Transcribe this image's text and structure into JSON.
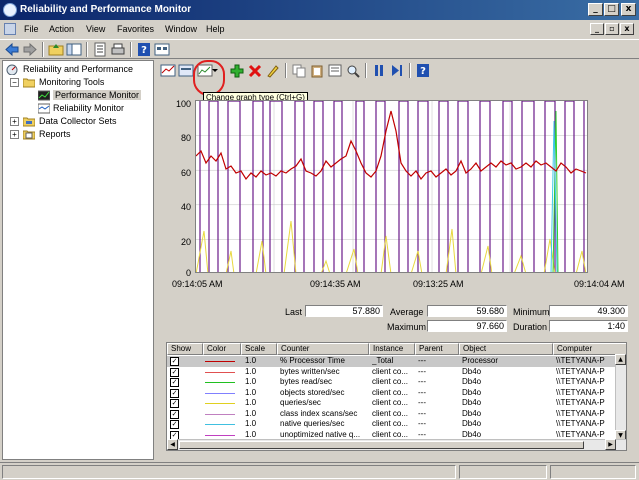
{
  "window": {
    "title": "Reliability and Performance Monitor"
  },
  "menu": [
    "File",
    "Action",
    "View",
    "Favorites",
    "Window",
    "Help"
  ],
  "window_buttons": {
    "minimize": "_",
    "maximize": "□",
    "close": "x"
  },
  "mdi_buttons": {
    "minimize": "_",
    "restore": "▫",
    "close": "x"
  },
  "tree": {
    "root": "Reliability and Performance",
    "monitoring_tools": "Monitoring Tools",
    "performance_monitor": "Performance Monitor",
    "reliability_monitor": "Reliability Monitor",
    "data_collector_sets": "Data Collector Sets",
    "reports": "Reports"
  },
  "tooltip": "Change graph type (Ctrl+G)",
  "graph": {
    "y_ticks": [
      "100",
      "80",
      "60",
      "40",
      "20",
      "0"
    ],
    "x_ticks": [
      "09:14:05 AM",
      "09:14:35 AM",
      "09:13:25 AM",
      "09:14:04 AM"
    ]
  },
  "stats": {
    "last_label": "Last",
    "last": "57.880",
    "average_label": "Average",
    "average": "59.680",
    "minimum_label": "Minimum",
    "minimum": "49.300",
    "maximum_label": "Maximum",
    "maximum": "97.660",
    "duration_label": "Duration",
    "duration": "1:40"
  },
  "list": {
    "headers": {
      "show": "Show",
      "color": "Color",
      "scale": "Scale",
      "counter": "Counter",
      "instance": "Instance",
      "parent": "Parent",
      "object": "Object",
      "computer": "Computer"
    },
    "rows": [
      {
        "scale": "1.0",
        "counter": "% Processor Time",
        "instance": "_Total",
        "parent": "---",
        "object": "Processor",
        "computer": "\\\\TETYANA-P",
        "color": "#c00000"
      },
      {
        "scale": "1.0",
        "counter": "bytes written/sec",
        "instance": "client co...",
        "parent": "---",
        "object": "Db4o",
        "computer": "\\\\TETYANA-P",
        "color": "#e05050"
      },
      {
        "scale": "1.0",
        "counter": "bytes read/sec",
        "instance": "client co...",
        "parent": "---",
        "object": "Db4o",
        "computer": "\\\\TETYANA-P",
        "color": "#20c020"
      },
      {
        "scale": "1.0",
        "counter": "objects stored/sec",
        "instance": "client co...",
        "parent": "---",
        "object": "Db4o",
        "computer": "\\\\TETYANA-P",
        "color": "#8080ff"
      },
      {
        "scale": "1.0",
        "counter": "queries/sec",
        "instance": "client co...",
        "parent": "---",
        "object": "Db4o",
        "computer": "\\\\TETYANA-P",
        "color": "#e0d020"
      },
      {
        "scale": "1.0",
        "counter": "class index scans/sec",
        "instance": "client co...",
        "parent": "---",
        "object": "Db4o",
        "computer": "\\\\TETYANA-P",
        "color": "#c080c0"
      },
      {
        "scale": "1.0",
        "counter": "native queries/sec",
        "instance": "client co...",
        "parent": "---",
        "object": "Db4o",
        "computer": "\\\\TETYANA-P",
        "color": "#40c0e0"
      },
      {
        "scale": "1.0",
        "counter": "unoptimized native q...",
        "instance": "client co...",
        "parent": "---",
        "object": "Db4o",
        "computer": "\\\\TETYANA-P",
        "color": "#c040c0"
      }
    ]
  },
  "colors": {
    "title_bar": "#0a246a",
    "selection": "#c8c8c8",
    "highlight": "#e02020"
  }
}
